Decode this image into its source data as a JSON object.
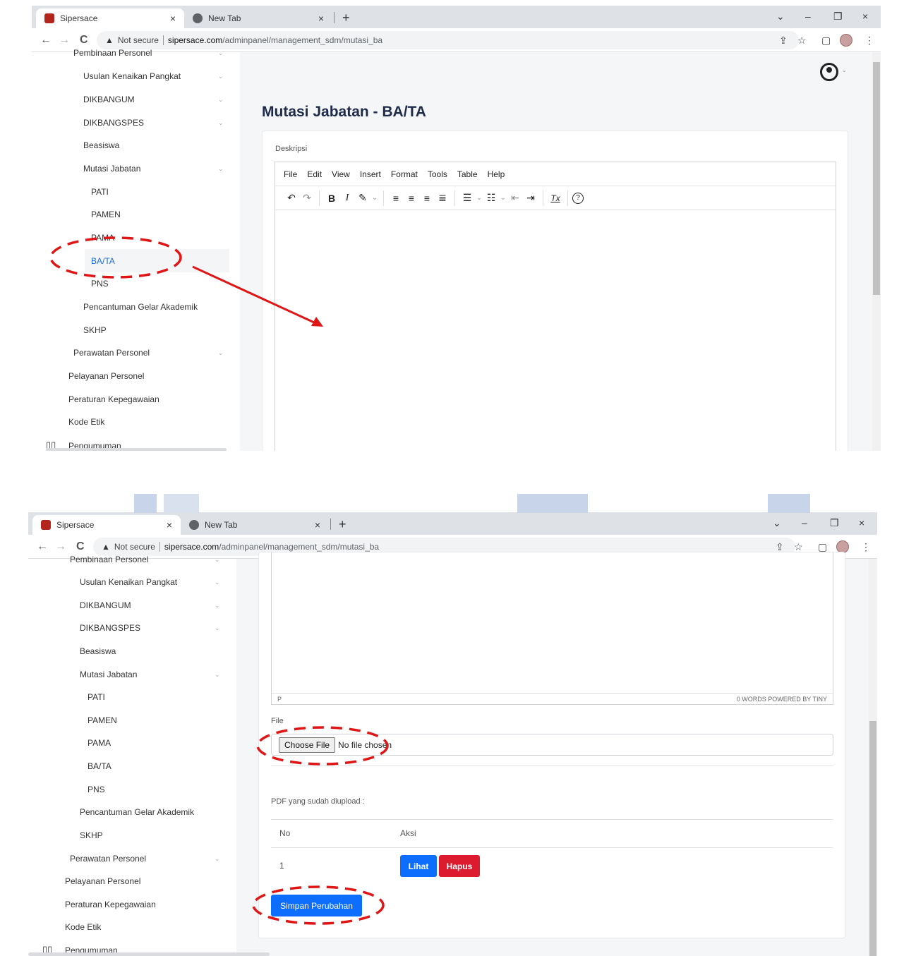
{
  "browser": {
    "tabs": [
      {
        "title": "Sipersace",
        "close": "×"
      },
      {
        "title": "New Tab",
        "close": "×"
      }
    ],
    "new_tab": "+",
    "window_controls": {
      "dropdown": "⌄",
      "minimize": "–",
      "restore": "❐",
      "close": "×"
    },
    "nav": {
      "back": "←",
      "forward": "→",
      "reload": "C"
    },
    "address": {
      "warning_icon": "▲",
      "security": "Not secure",
      "host": "sipersace.com",
      "path": "/adminpanel/management_sdm/mutasi_ba"
    },
    "toolbar_icons": {
      "share": "⇪",
      "bookmark": "☆",
      "sidepanel": "▢",
      "menu": "⋮"
    }
  },
  "sidebar": {
    "items": [
      {
        "label": "Pembinaan Personel"
      },
      {
        "label": "Usulan Kenaikan Pangkat"
      },
      {
        "label": "DIKBANGUM"
      },
      {
        "label": "DIKBANGSPES"
      },
      {
        "label": "Beasiswa"
      },
      {
        "label": "Mutasi Jabatan"
      },
      {
        "label": "PATI"
      },
      {
        "label": "PAMEN"
      },
      {
        "label": "PAMA"
      },
      {
        "label": "BA/TA"
      },
      {
        "label": "PNS"
      },
      {
        "label": "Pencantuman Gelar Akademik"
      },
      {
        "label": "SKHP"
      },
      {
        "label": "Perawatan Personel"
      },
      {
        "label": "Pelayanan Personel"
      },
      {
        "label": "Peraturan Kepegawaian"
      },
      {
        "label": "Kode Etik"
      },
      {
        "label": "Pengumuman"
      }
    ],
    "chevron": "⌄",
    "book_icon": "▯▯"
  },
  "page": {
    "title": "Mutasi Jabatan - BA/TA",
    "user_chevron": "⌄",
    "description_label": "Deskripsi",
    "editor": {
      "menu": [
        "File",
        "Edit",
        "View",
        "Insert",
        "Format",
        "Tools",
        "Table",
        "Help"
      ],
      "toolbar": {
        "undo": "↶",
        "redo": "↷",
        "bold": "B",
        "italic": "I",
        "highlight": "✎",
        "caret": "⌄",
        "align_left": "≡",
        "align_center": "≡",
        "align_right": "≡",
        "justify": "≣",
        "bullet_list": "☰",
        "numbered_list": "☷",
        "outdent": "⇤",
        "indent": "⇥",
        "clear_format": "Tx",
        "help": "?"
      },
      "status_left": "P",
      "status_right": "0 WORDS  POWERED BY TINY"
    },
    "file_label": "File",
    "file_input": {
      "button": "Choose File",
      "status": "No file chosen"
    },
    "uploaded_label": "PDF yang sudah diupload :",
    "table": {
      "headers": [
        "No",
        "Aksi"
      ],
      "rows": [
        {
          "no": "1",
          "view": "Lihat",
          "delete": "Hapus"
        }
      ]
    },
    "save_button": "Simpan Perubahan"
  },
  "colors": {
    "accent": "#0d6efd",
    "danger": "#dc1c2e",
    "active_link": "#1e6fd9",
    "annotation": "#e01616"
  }
}
